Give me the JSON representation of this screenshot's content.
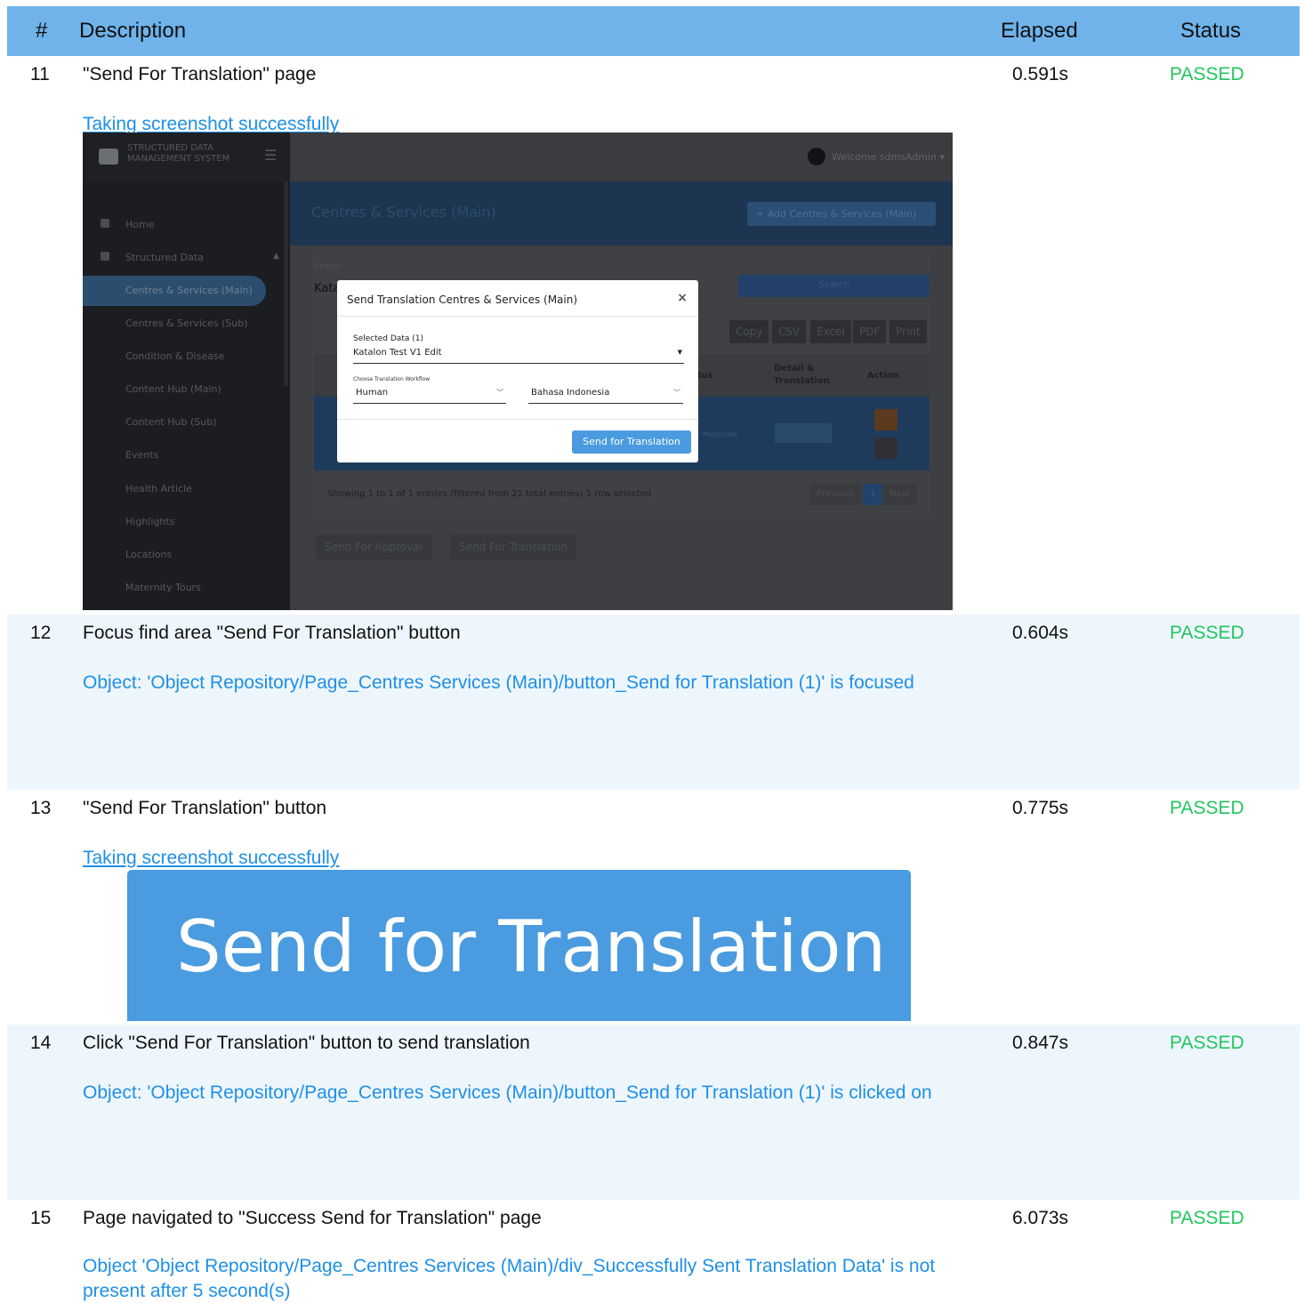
{
  "header": {
    "num": "#",
    "description": "Description",
    "elapsed": "Elapsed",
    "status": "Status"
  },
  "rows": [
    {
      "num": "11",
      "description": "\"Send For Translation\" page",
      "elapsed": "0.591s",
      "status": "PASSED",
      "message": "Taking screenshot successfully"
    },
    {
      "num": "12",
      "description": "Focus find area \"Send For Translation\" button",
      "elapsed": "0.604s",
      "status": "PASSED",
      "message": "Object: 'Object Repository/Page_Centres  Services (Main)/button_Send for Translation (1)' is focused"
    },
    {
      "num": "13",
      "description": "\"Send For Translation\" button",
      "elapsed": "0.775s",
      "status": "PASSED",
      "message": "Taking screenshot successfully"
    },
    {
      "num": "14",
      "description": "Click \"Send For Translation\" button to send translation",
      "elapsed": "0.847s",
      "status": "PASSED",
      "message": "Object: 'Object Repository/Page_Centres  Services (Main)/button_Send for Translation (1)' is clicked on"
    },
    {
      "num": "15",
      "description": "Page navigated to \"Success Send for Translation\" page",
      "elapsed": "6.073s",
      "status": "PASSED",
      "message": "Object 'Object Repository/Page_Centres  Services (Main)/div_Successfully Sent Translation Data' is not present after 5 second(s)"
    }
  ],
  "screenshot1": {
    "brand": "STRUCTURED DATA MANAGEMENT SYSTEM",
    "welcome": "Welcome sdmsAdmin ▾",
    "page_title": "Centres & Services (Main)",
    "add_button": "+ Add Centres & Services (Main)",
    "search_label": "Search",
    "search_value": "Kata",
    "search_button": "Search",
    "sidebar": [
      {
        "label": "Home",
        "icon": "home-icon"
      },
      {
        "label": "Structured Data",
        "icon": "database-icon"
      },
      {
        "label": "Centres & Services (Main)"
      },
      {
        "label": "Centres & Services (Sub)"
      },
      {
        "label": "Condition & Disease"
      },
      {
        "label": "Content Hub (Main)"
      },
      {
        "label": "Content Hub (Sub)"
      },
      {
        "label": "Events"
      },
      {
        "label": "Health Article"
      },
      {
        "label": "Highlights"
      },
      {
        "label": "Locations"
      },
      {
        "label": "Maternity Tours"
      }
    ],
    "export_buttons": [
      "Copy",
      "CSV",
      "Excel",
      "PDF",
      "Print"
    ],
    "table_headers": {
      "status": "tus",
      "detail": "Detail & Translation",
      "action": "Action"
    },
    "row_status": "Published",
    "footer_text": "Showing 1 to 1 of 1 entries (filtered from 21 total entries)   1 row selected",
    "pagination": [
      "Previous",
      "1",
      "Next"
    ],
    "bottom_buttons": [
      "Send For Approval",
      "Send For Translation"
    ],
    "modal": {
      "title": "Send Translation Centres & Services (Main)",
      "close": "×",
      "selected_label": "Selected Data (1)",
      "selected_value": "Katalon Test V1 Edit",
      "workflow_label": "Choose Translation Workflow",
      "workflow_value": "Human",
      "language_value": "Bahasa Indonesia",
      "send_button": "Send for Translation"
    }
  },
  "screenshot2": {
    "button_label": "Send for Translation"
  },
  "colors": {
    "header": "#6fb3ea",
    "passed": "#22c55e",
    "link": "#1e90e6",
    "alt_row": "#eef6fd",
    "button": "#4a9be0"
  }
}
